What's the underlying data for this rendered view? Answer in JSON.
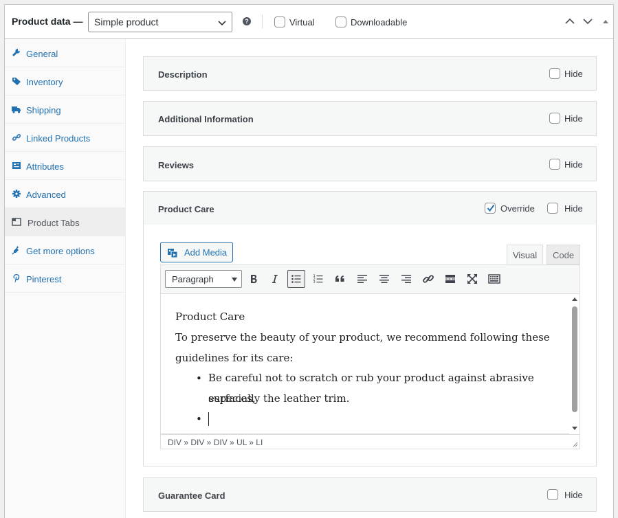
{
  "header": {
    "title": "Product data —",
    "product_type": "Simple product",
    "help": "?",
    "virtual_label": "Virtual",
    "downloadable_label": "Downloadable"
  },
  "sidebar": {
    "items": [
      {
        "label": "General",
        "icon": "wrench-icon"
      },
      {
        "label": "Inventory",
        "icon": "tag-icon"
      },
      {
        "label": "Shipping",
        "icon": "truck-icon"
      },
      {
        "label": "Linked Products",
        "icon": "link-icon"
      },
      {
        "label": "Attributes",
        "icon": "list-icon"
      },
      {
        "label": "Advanced",
        "icon": "gear-icon"
      },
      {
        "label": "Product Tabs",
        "icon": "tabs-icon",
        "active": true
      },
      {
        "label": "Get more options",
        "icon": "plugin-icon"
      },
      {
        "label": "Pinterest",
        "icon": "pinterest-icon"
      }
    ]
  },
  "tabs": {
    "description": {
      "title": "Description",
      "hide": "Hide"
    },
    "additional": {
      "title": "Additional Information",
      "hide": "Hide"
    },
    "reviews": {
      "title": "Reviews",
      "hide": "Hide"
    },
    "care": {
      "title": "Product Care",
      "override": "Override",
      "hide": "Hide"
    },
    "guarantee": {
      "title": "Guarantee Card",
      "hide": "Hide"
    }
  },
  "editor": {
    "add_media": "Add Media",
    "tab_visual": "Visual",
    "tab_code": "Code",
    "format": "Paragraph",
    "content": {
      "line1": "Product Care",
      "line2": "To preserve the beauty of your product, we recommend following these",
      "line3": "guidelines for its care:",
      "bullet": "•",
      "li1_a": "Be careful not to scratch or rub your product against abrasive surfaces,",
      "li1_b": "especially the leather trim."
    },
    "path": "DIV » DIV » DIV » UL » LI"
  }
}
